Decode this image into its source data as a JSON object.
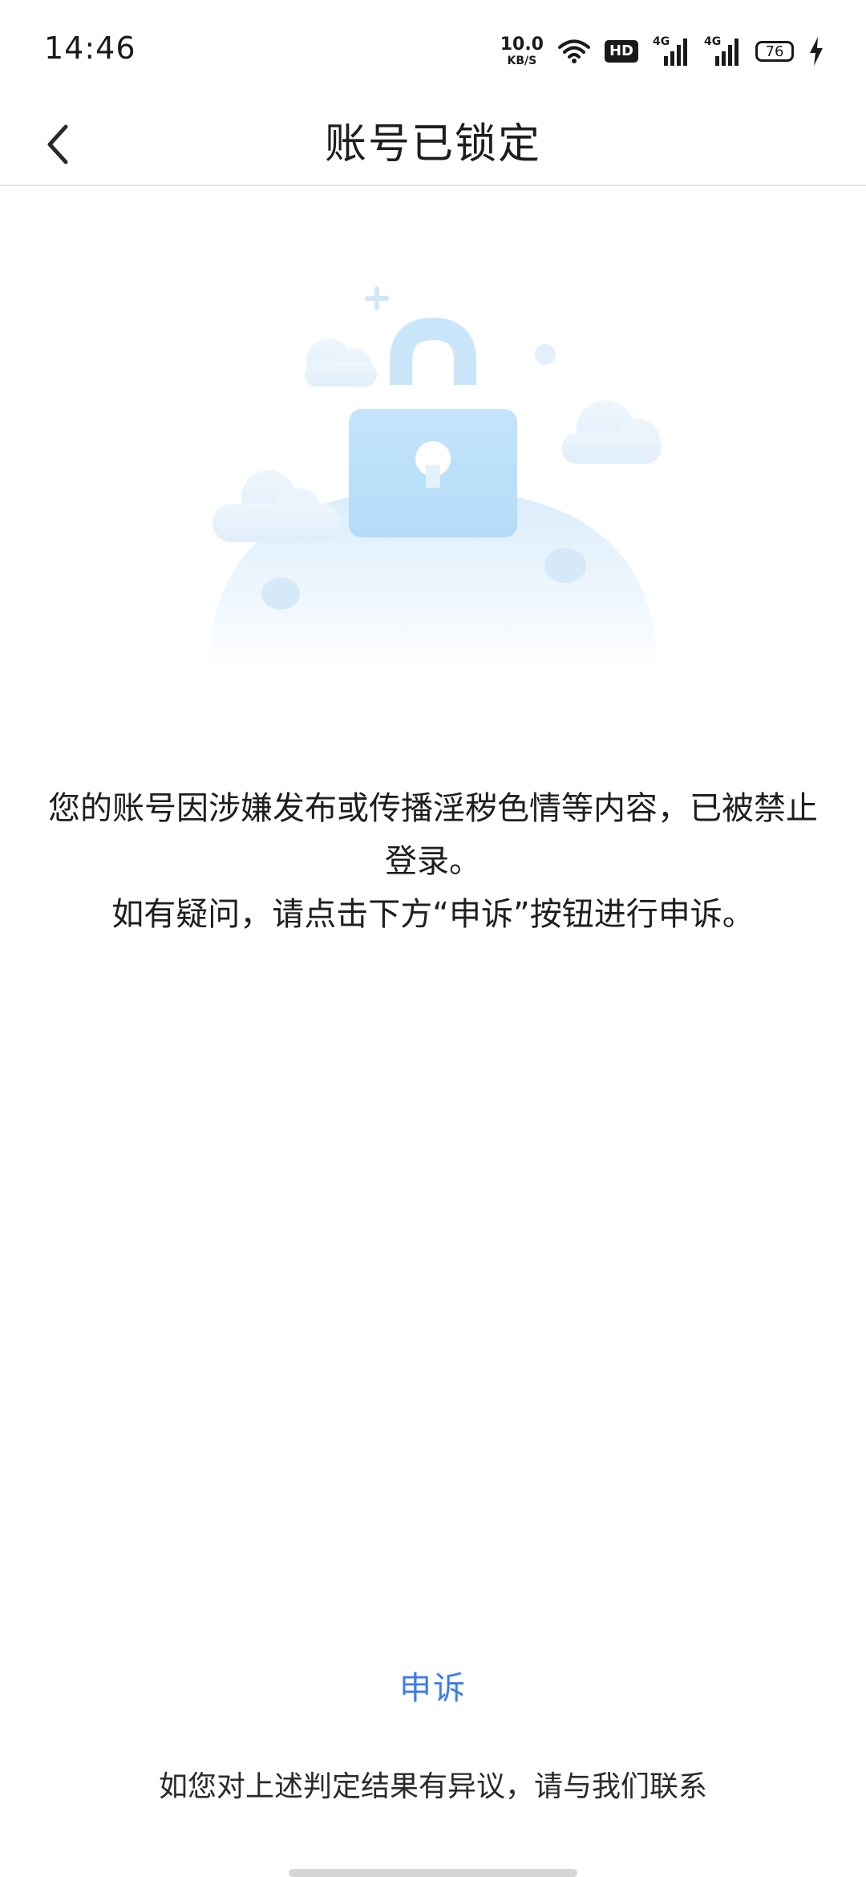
{
  "status_bar": {
    "time": "14:46",
    "net_speed_value": "10.0",
    "net_speed_unit": "KB/S",
    "hd_label": "HD",
    "sim1_tag": "4G",
    "sim2_tag": "4G",
    "battery_level": "76",
    "icons": [
      "wifi-icon",
      "hd-icon",
      "signal-icon",
      "signal-icon",
      "battery-icon",
      "charging-icon"
    ]
  },
  "header": {
    "title": "账号已锁定",
    "back_icon": "chevron-left-icon"
  },
  "illustration": {
    "icon": "lock-icon",
    "accent_color": "#bfe3fb"
  },
  "message": {
    "line1": "您的账号因涉嫌发布或传播淫秽色情等内容，已被禁止登录。",
    "line2": "如有疑问，请点击下方“申诉”按钮进行申诉。"
  },
  "actions": {
    "appeal_label": "申诉",
    "appeal_color": "#3b7de9"
  },
  "footer": {
    "contact_text": "如您对上述判定结果有异议，请与我们联系"
  }
}
